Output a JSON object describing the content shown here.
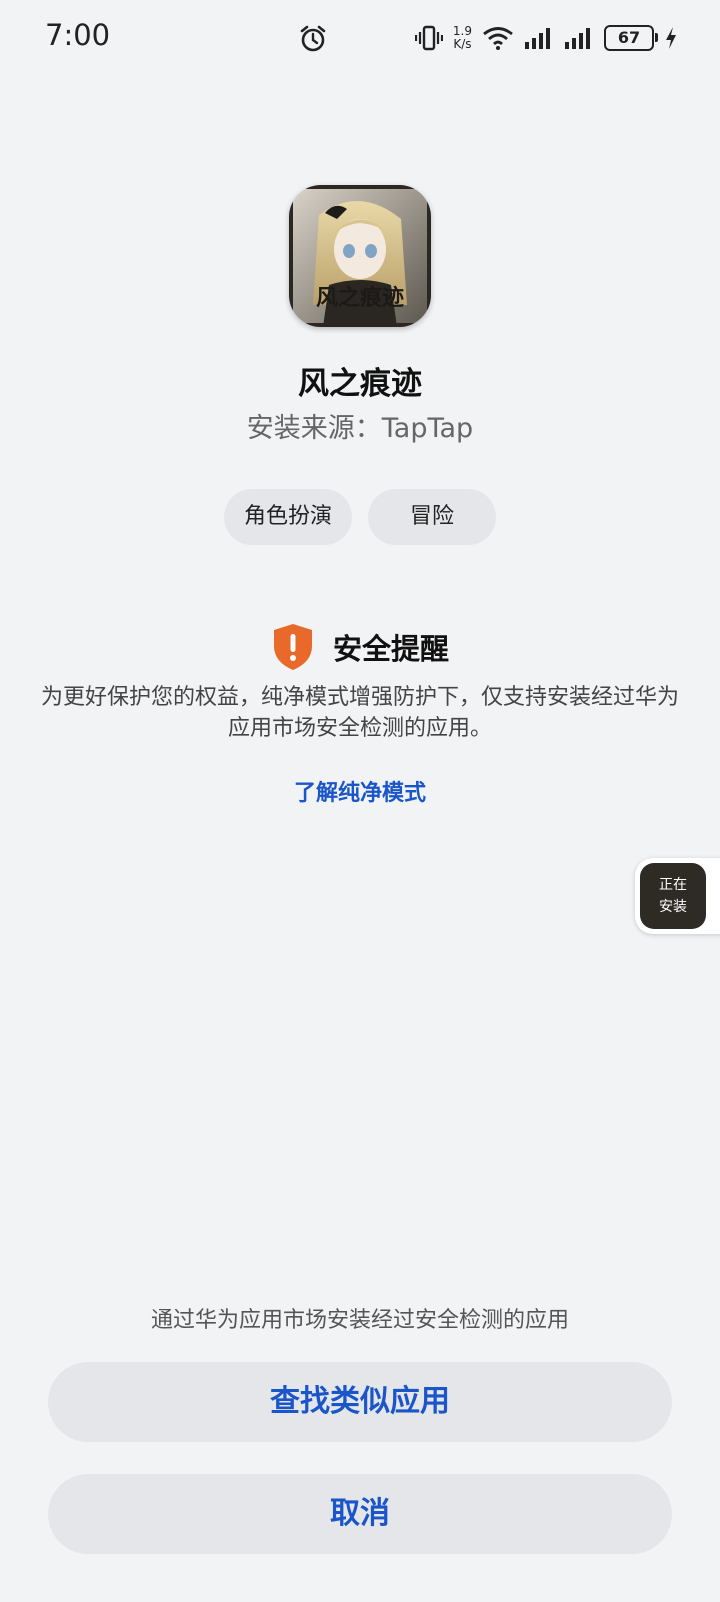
{
  "status_bar": {
    "time": "7:00",
    "net_speed_value": "1.9",
    "net_speed_unit": "K/s",
    "battery_level": "67"
  },
  "app": {
    "name": "风之痕迹",
    "source": "安装来源：TapTap",
    "icon_text": "风之痕迹"
  },
  "tags": [
    "角色扮演",
    "冒险"
  ],
  "security": {
    "title": "安全提醒",
    "description": "为更好保护您的权益，纯净模式增强防护下，仅支持安装经过华为应用市场安全检测的应用。",
    "learn_more": "了解纯净模式"
  },
  "install_chip": {
    "line1": "正在",
    "line2": "安装"
  },
  "bottom": {
    "hint": "通过华为应用市场安装经过安全检测的应用",
    "find_similar": "查找类似应用",
    "cancel": "取消"
  },
  "colors": {
    "background": "#f1f3f5",
    "accent": "#1a56c9",
    "warning": "#e8692a",
    "button_bg": "#e4e6e9"
  }
}
